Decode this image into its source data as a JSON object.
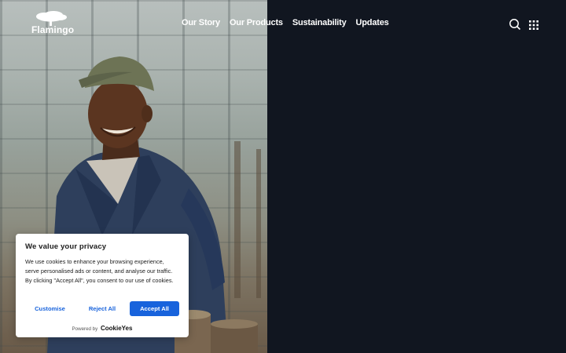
{
  "brand": {
    "name": "Flamingo"
  },
  "nav": {
    "items": [
      {
        "label": "Our Story"
      },
      {
        "label": "Our Products"
      },
      {
        "label": "Sustainability"
      },
      {
        "label": "Updates"
      }
    ]
  },
  "header_icons": {
    "search": "search-icon",
    "menu": "grid-menu-icon"
  },
  "colors": {
    "background": "#111620",
    "accent": "#1863dc",
    "text_on_dark": "#ffffff"
  },
  "cookie_banner": {
    "title": "We value your privacy",
    "body": "We use cookies to enhance your browsing experience, serve personalised ads or content, and analyse our traffic. By clicking \"Accept All\", you consent to our use of cookies.",
    "customise_label": "Customise",
    "reject_label": "Reject All",
    "accept_label": "Accept All",
    "powered_by": "Powered by",
    "powered_brand": "CookieYes"
  }
}
